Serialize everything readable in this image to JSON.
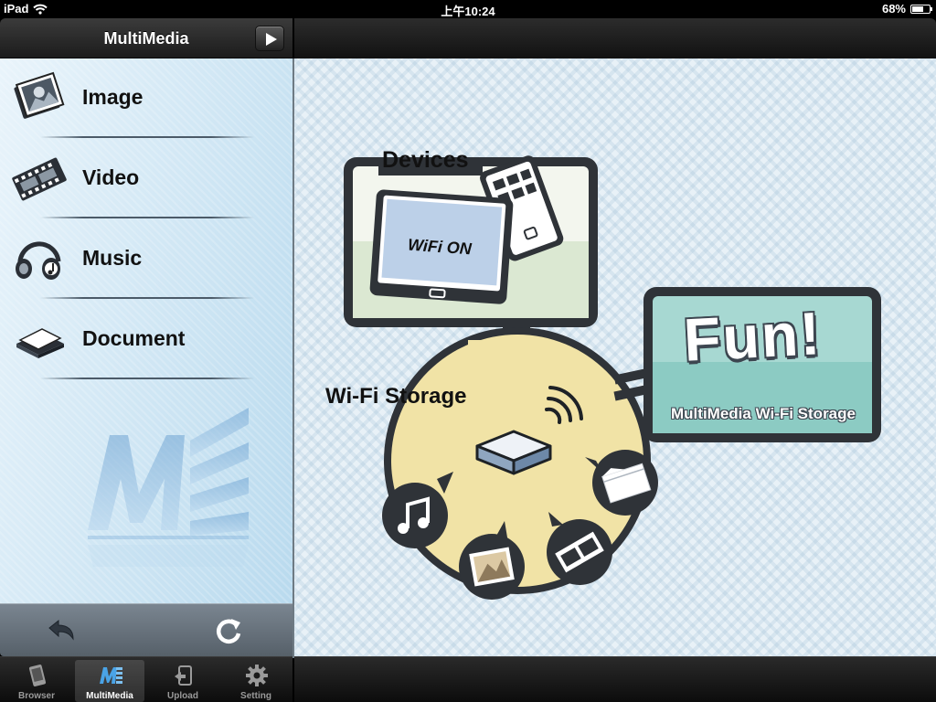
{
  "status_bar": {
    "device": "iPad",
    "time": "上午10:24",
    "battery": "68%",
    "battery_level": 0.68
  },
  "nav": {
    "title": "MultiMedia",
    "play_icon": "play-icon"
  },
  "menu": [
    {
      "label": "Image",
      "icon": "image-icon"
    },
    {
      "label": "Video",
      "icon": "video-icon"
    },
    {
      "label": "Music",
      "icon": "music-icon"
    },
    {
      "label": "Document",
      "icon": "document-icon"
    }
  ],
  "left_toolbar": {
    "back_icon": "back-arrow-icon",
    "refresh_icon": "refresh-icon"
  },
  "illustration": {
    "devices_label": "Devices",
    "tablet_text": "WiFi ON",
    "storage_label": "Wi-Fi Storage",
    "fun_text": "Fun!",
    "fun_caption": "MultiMedia Wi-Fi Storage"
  },
  "tabs": [
    {
      "label": "Browser",
      "icon": "browser-icon",
      "selected": false
    },
    {
      "label": "MultiMedia",
      "icon": "multimedia-icon",
      "selected": true
    },
    {
      "label": "Upload",
      "icon": "upload-icon",
      "selected": false
    },
    {
      "label": "Setting",
      "icon": "gear-icon",
      "selected": false
    }
  ],
  "colors": {
    "storage_yellow": "#f1e3a6",
    "fun_teal": "#a7d8d2",
    "watermark_blue": "#7fb0d8"
  }
}
